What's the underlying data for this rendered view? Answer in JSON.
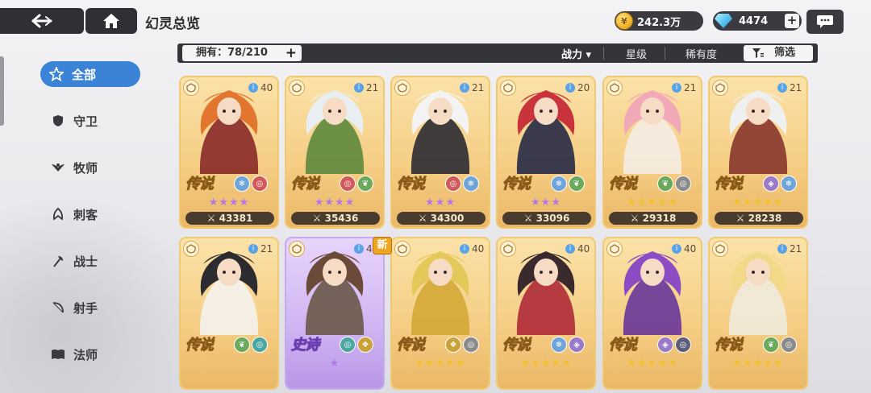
{
  "header": {
    "title": "幻灵总览",
    "gold": "242.3万",
    "gems": "4474",
    "plus_symbol": "+"
  },
  "filterbar": {
    "owned_label": "拥有：78/210",
    "owned_plus": "+",
    "sort_power": "战力 ▾",
    "sort_star": "星级",
    "sort_rarity": "稀有度",
    "filter_label": "筛选"
  },
  "sidebar": {
    "items": [
      {
        "label": "全部",
        "icon": "star-outline-icon",
        "active": true
      },
      {
        "label": "守卫",
        "icon": "shield-icon"
      },
      {
        "label": "牧师",
        "icon": "wings-icon"
      },
      {
        "label": "刺客",
        "icon": "dagger-icon"
      },
      {
        "label": "战士",
        "icon": "axe-icon"
      },
      {
        "label": "射手",
        "icon": "bow-icon"
      },
      {
        "label": "法师",
        "icon": "book-icon"
      }
    ]
  },
  "cards": [
    {
      "level": "40",
      "rarity": "传说",
      "stars": "★★★★",
      "star_color": "purple",
      "power": "43381",
      "elements": [
        "ice",
        "wind-red"
      ]
    },
    {
      "level": "21",
      "rarity": "传说",
      "stars": "★★★★",
      "star_color": "purple",
      "power": "35436",
      "elements": [
        "wind-red",
        "leaf"
      ]
    },
    {
      "level": "21",
      "rarity": "传说",
      "stars": "★★★",
      "star_color": "purple",
      "power": "34300",
      "elements": [
        "wind-red",
        "ice"
      ]
    },
    {
      "level": "20",
      "rarity": "传说",
      "stars": "★★★",
      "star_color": "purple",
      "power": "33096",
      "elements": [
        "ice",
        "leaf"
      ]
    },
    {
      "level": "21",
      "rarity": "传说",
      "stars": "★★★★★",
      "star_color": "gold",
      "power": "29318",
      "elements": [
        "leaf",
        "swirl"
      ]
    },
    {
      "level": "21",
      "rarity": "传说",
      "stars": "★★★★★",
      "star_color": "gold",
      "power": "28238",
      "elements": [
        "void",
        "ice"
      ]
    },
    {
      "level": "21",
      "rarity": "传说",
      "stars": "",
      "star_color": "gold",
      "power": "",
      "elements": [
        "leaf",
        "water"
      ]
    },
    {
      "level": "40",
      "rarity": "史诗",
      "stars": "★",
      "star_color": "purple",
      "power": "",
      "elements": [
        "water",
        "wind-gold"
      ]
    },
    {
      "level": "40",
      "rarity": "传说",
      "stars": "★★★★★",
      "star_color": "gold",
      "power": "",
      "elements": [
        "wind-gold",
        "swirl"
      ]
    },
    {
      "level": "40",
      "rarity": "传说",
      "stars": "★★★★★",
      "star_color": "gold",
      "power": "",
      "elements": [
        "ice",
        "void"
      ]
    },
    {
      "level": "40",
      "rarity": "传说",
      "stars": "★★★★★",
      "star_color": "gold",
      "power": "",
      "elements": [
        "void",
        "void-dark"
      ]
    },
    {
      "level": "21",
      "rarity": "传说",
      "stars": "★★★★★",
      "star_color": "gold",
      "power": "",
      "elements": [
        "leaf",
        "swirl"
      ]
    }
  ],
  "new_badge": "新",
  "colors": {
    "accent_blue": "#3b83d6",
    "dark_bar": "#34353b",
    "legend_border": "#f1c971",
    "epic_border": "#c7a9ef"
  }
}
